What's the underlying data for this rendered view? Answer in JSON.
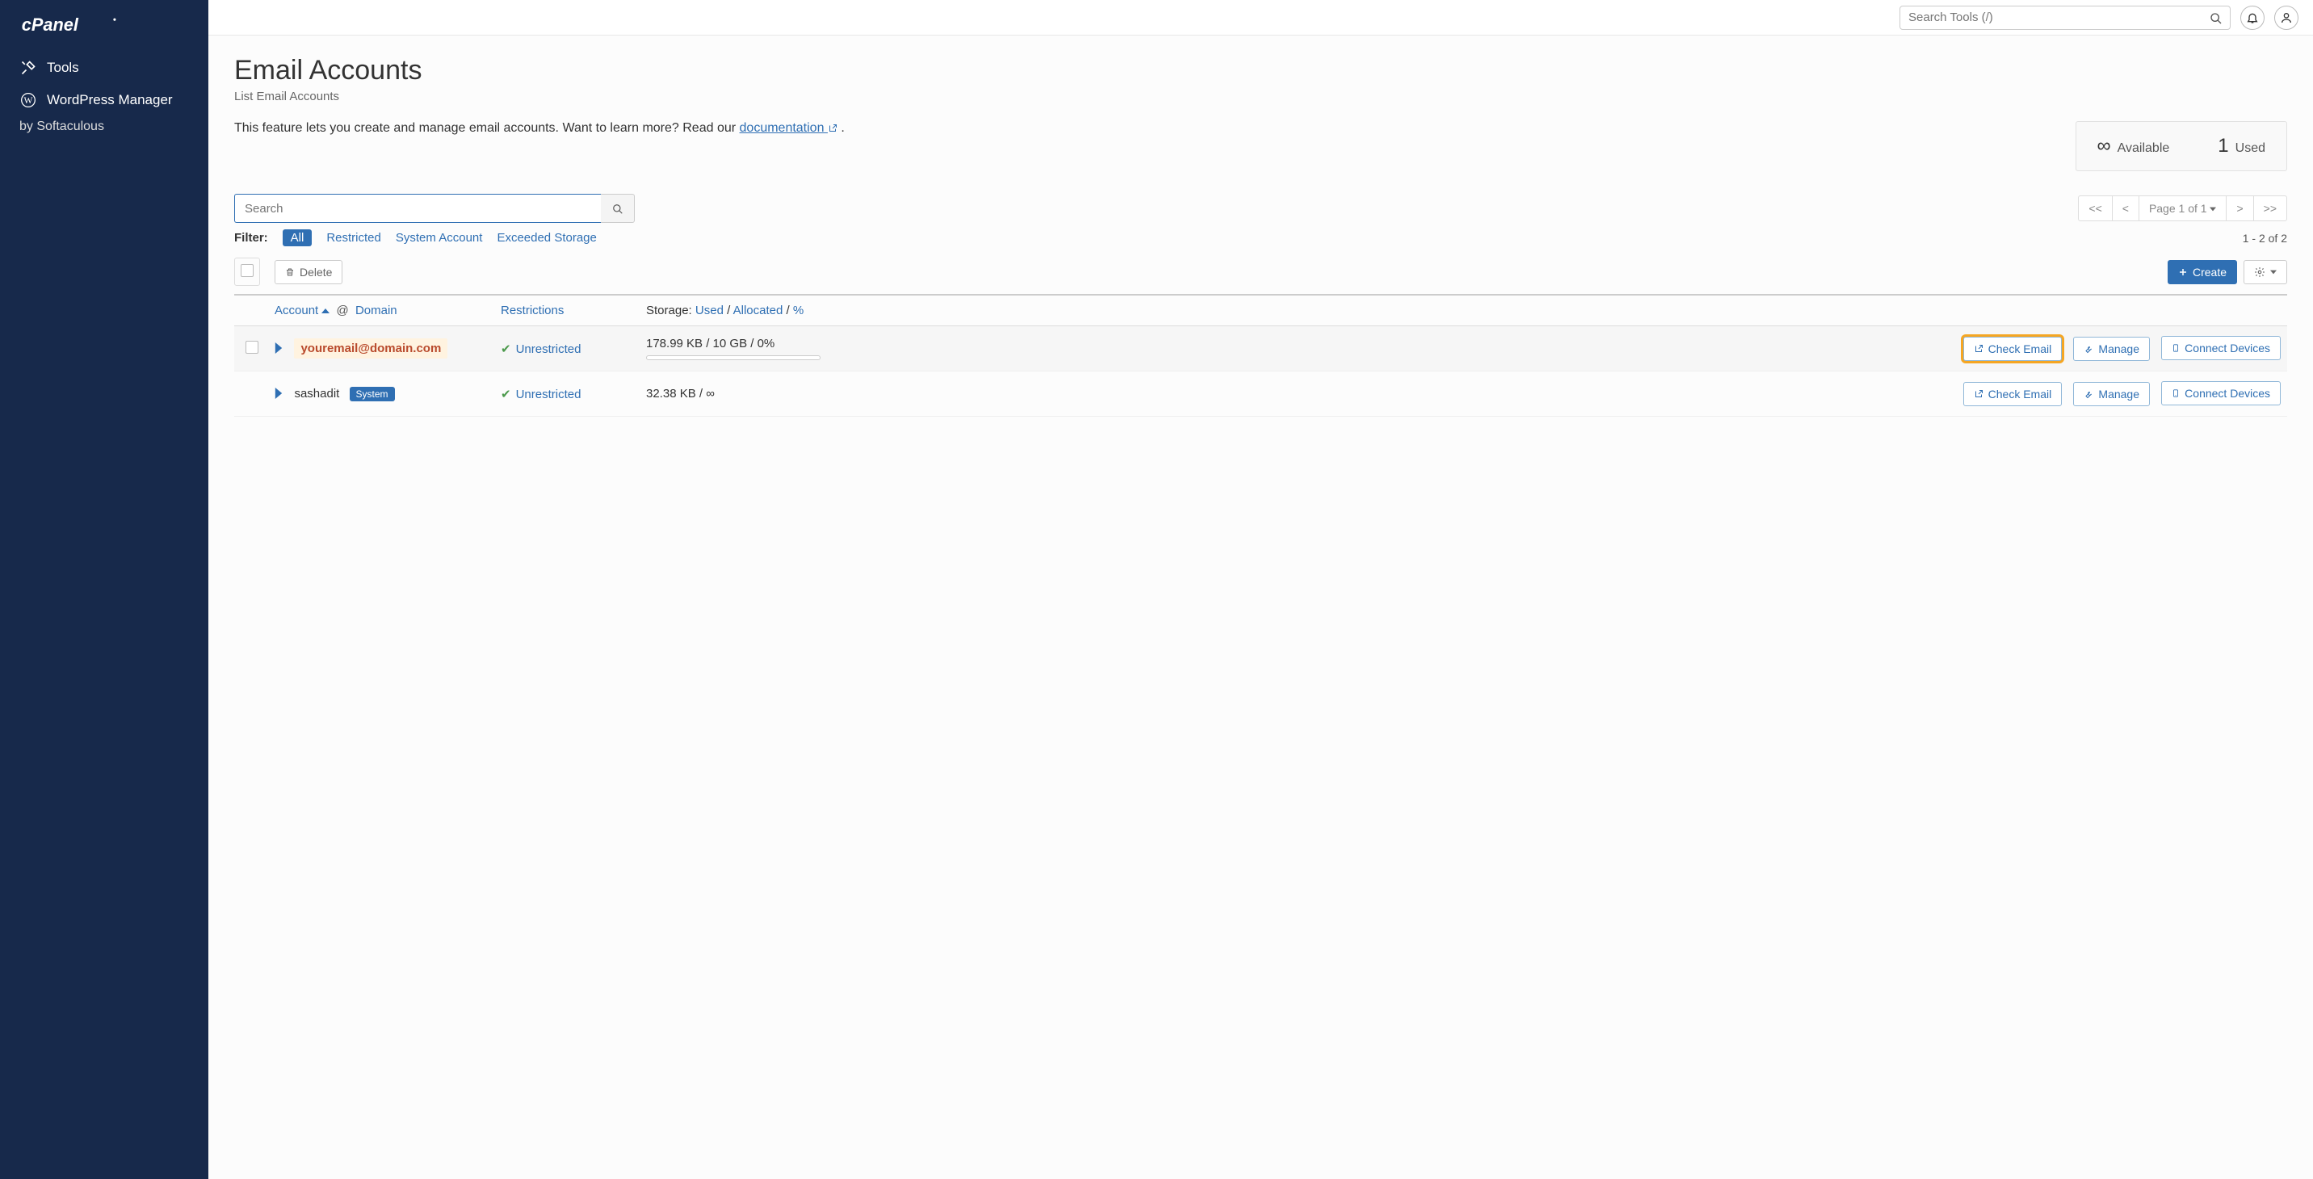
{
  "sidebar": {
    "items": [
      {
        "label": "Tools"
      },
      {
        "label": "WordPress Manager"
      }
    ],
    "sub": "by Softaculous"
  },
  "topbar": {
    "search_placeholder": "Search Tools (/)"
  },
  "page": {
    "title": "Email Accounts",
    "subtitle": "List Email Accounts",
    "intro_prefix": "This feature lets you create and manage email accounts. Want to learn more? Read our ",
    "intro_link": "documentation",
    "intro_suffix": " ."
  },
  "stats": {
    "available_value": "∞",
    "available_label": "Available",
    "used_value": "1",
    "used_label": "Used"
  },
  "search": {
    "placeholder": "Search"
  },
  "pagination": {
    "first": "<<",
    "prev": "<",
    "page_label": "Page 1 of 1",
    "next": ">",
    "last": ">>",
    "range": "1 - 2 of 2"
  },
  "filters": {
    "label": "Filter:",
    "all": "All",
    "restricted": "Restricted",
    "system": "System Account",
    "exceeded": "Exceeded Storage"
  },
  "actions": {
    "delete": "Delete",
    "create": "Create"
  },
  "columns": {
    "account": "Account",
    "at": "@",
    "domain": "Domain",
    "restrictions": "Restrictions",
    "storage_label": "Storage:",
    "used": "Used",
    "sep": "/",
    "allocated": "Allocated",
    "percent": "%"
  },
  "row_buttons": {
    "check_email": "Check Email",
    "manage": "Manage",
    "connect": "Connect Devices"
  },
  "rows": [
    {
      "account": "youremail@domain.com",
      "restriction": "Unrestricted",
      "storage": "178.99 KB / 10 GB / 0%",
      "highlighted": true,
      "has_checkbox": true,
      "system": false
    },
    {
      "account": "sashadit",
      "restriction": "Unrestricted",
      "storage": "32.38 KB / ∞",
      "highlighted": false,
      "has_checkbox": false,
      "system": true,
      "system_label": "System"
    }
  ]
}
